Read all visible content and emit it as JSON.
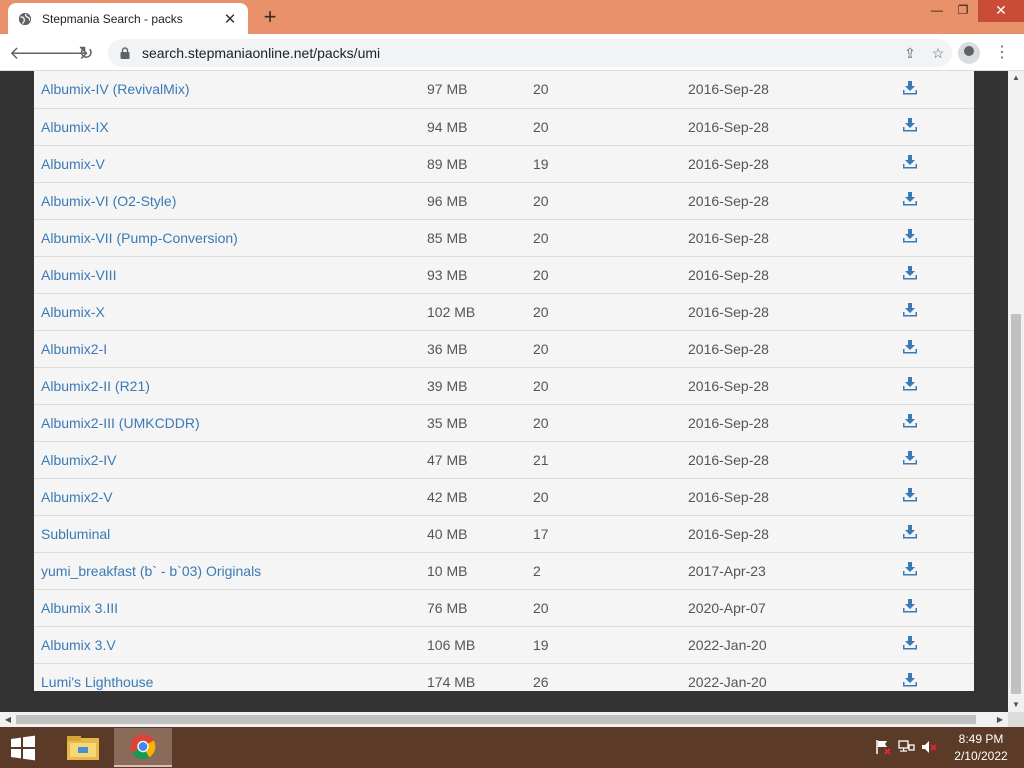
{
  "browser": {
    "tab_title": "Stepmania Search - packs",
    "new_tab_label": "+",
    "url": "search.stepmaniaonline.net/packs/umi"
  },
  "packs": [
    {
      "name": "Albumix-IV (RevivalMix)",
      "size": "97 MB",
      "count": "20",
      "date": "2016-Sep-28"
    },
    {
      "name": "Albumix-IX",
      "size": "94 MB",
      "count": "20",
      "date": "2016-Sep-28"
    },
    {
      "name": "Albumix-V",
      "size": "89 MB",
      "count": "19",
      "date": "2016-Sep-28"
    },
    {
      "name": "Albumix-VI (O2-Style)",
      "size": "96 MB",
      "count": "20",
      "date": "2016-Sep-28"
    },
    {
      "name": "Albumix-VII (Pump-Conversion)",
      "size": "85 MB",
      "count": "20",
      "date": "2016-Sep-28"
    },
    {
      "name": "Albumix-VIII",
      "size": "93 MB",
      "count": "20",
      "date": "2016-Sep-28"
    },
    {
      "name": "Albumix-X",
      "size": "102 MB",
      "count": "20",
      "date": "2016-Sep-28"
    },
    {
      "name": "Albumix2-I",
      "size": "36 MB",
      "count": "20",
      "date": "2016-Sep-28"
    },
    {
      "name": "Albumix2-II (R21)",
      "size": "39 MB",
      "count": "20",
      "date": "2016-Sep-28"
    },
    {
      "name": "Albumix2-III (UMKCDDR)",
      "size": "35 MB",
      "count": "20",
      "date": "2016-Sep-28"
    },
    {
      "name": "Albumix2-IV",
      "size": "47 MB",
      "count": "21",
      "date": "2016-Sep-28"
    },
    {
      "name": "Albumix2-V",
      "size": "42 MB",
      "count": "20",
      "date": "2016-Sep-28"
    },
    {
      "name": "Subluminal",
      "size": "40 MB",
      "count": "17",
      "date": "2016-Sep-28"
    },
    {
      "name": "yumi_breakfast (b` - b`03) Originals",
      "size": "10 MB",
      "count": "2",
      "date": "2017-Apr-23"
    },
    {
      "name": "Albumix 3.III",
      "size": "76 MB",
      "count": "20",
      "date": "2020-Apr-07"
    },
    {
      "name": "Albumix 3.V",
      "size": "106 MB",
      "count": "19",
      "date": "2022-Jan-20"
    },
    {
      "name": "Lumi's Lighthouse",
      "size": "174 MB",
      "count": "26",
      "date": "2022-Jan-20"
    }
  ],
  "taskbar": {
    "time": "8:49 PM",
    "date": "2/10/2022"
  },
  "colors": {
    "titlebar": "#e8916a",
    "link": "#3a7ab5",
    "taskbar": "#5b3a27"
  },
  "icons": {
    "download": "download-icon",
    "tab_favicon": "globe-icon"
  }
}
